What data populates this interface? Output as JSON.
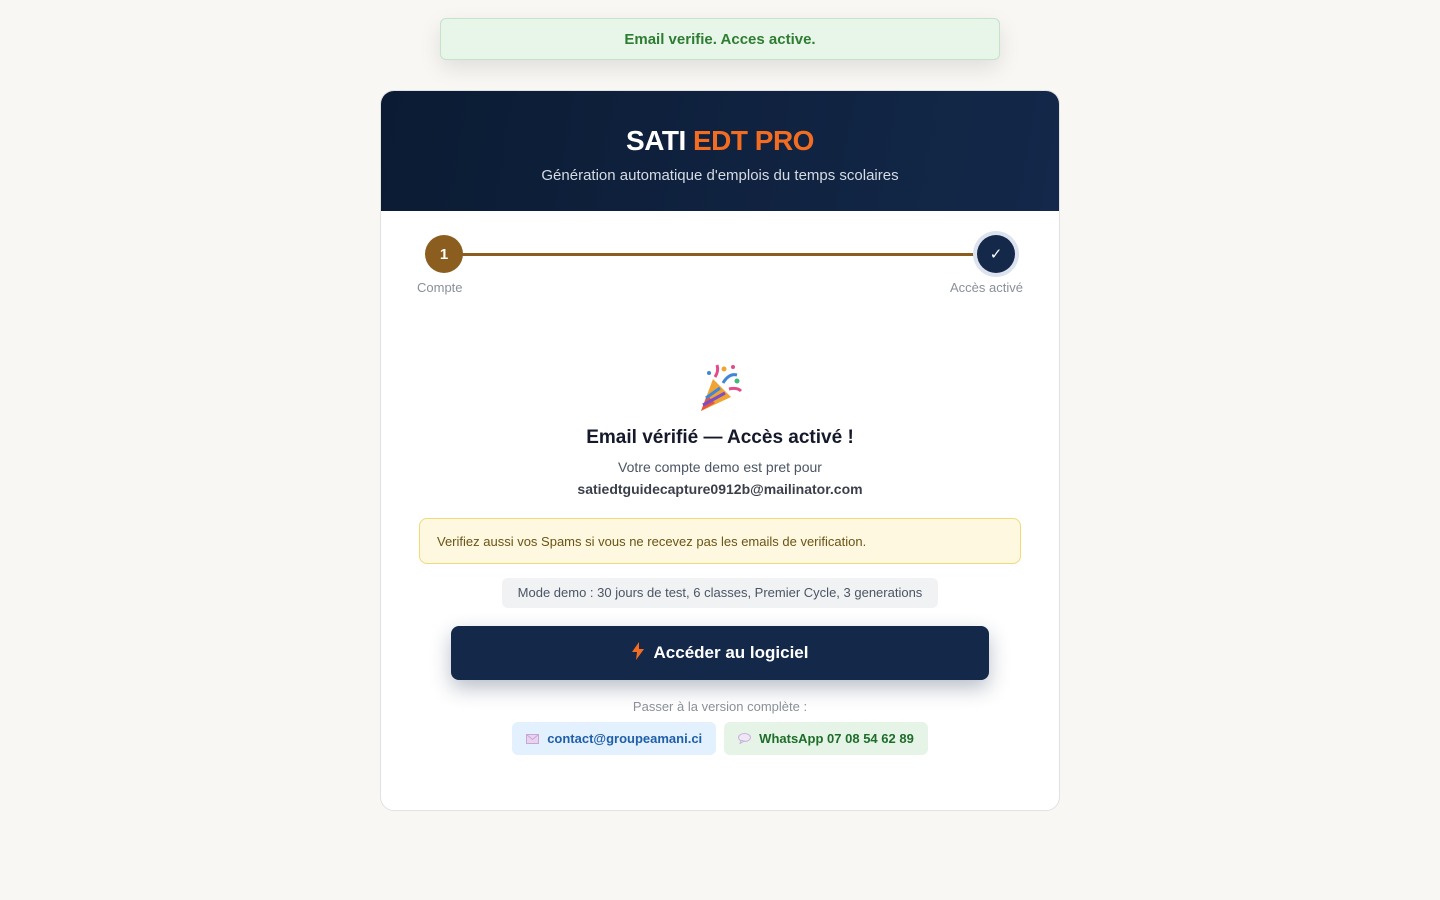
{
  "toast": {
    "message": "Email verifie. Acces active."
  },
  "header": {
    "brand_part1": "SATI",
    "brand_part2": "EDT PRO",
    "subtitle": "Génération automatique d'emplois du temps scolaires"
  },
  "stepper": {
    "steps": [
      {
        "number": "1",
        "label": "Compte",
        "state": "done"
      },
      {
        "number": "✓",
        "label": "Accès activé",
        "state": "current"
      }
    ]
  },
  "success": {
    "icon": "party-popper-icon",
    "title": "Email vérifié — Accès activé !",
    "description": "Votre compte demo est pret pour",
    "email": "satiedtguidecapture0912b@mailinator.com"
  },
  "notice": {
    "text": "Verifiez aussi vos Spams si vous ne recevez pas les emails de verification."
  },
  "demo_info": {
    "text": "Mode demo : 30 jours de test, 6 classes, Premier Cycle, 3 generations"
  },
  "cta": {
    "icon": "lightning-icon",
    "label": "Accéder au logiciel"
  },
  "upgrade": {
    "label": "Passer à la version complète :",
    "contacts": [
      {
        "icon": "envelope-icon",
        "label": "contact@groupeamani.ci"
      },
      {
        "icon": "speech-bubble-icon",
        "label": "WhatsApp 07 08 54 62 89"
      }
    ]
  },
  "colors": {
    "navy": "#14284a",
    "accent_orange": "#f26d21",
    "step_brown": "#8b5e1f",
    "toast_green": "#2e7d32",
    "page_bg": "#f8f7f4"
  }
}
